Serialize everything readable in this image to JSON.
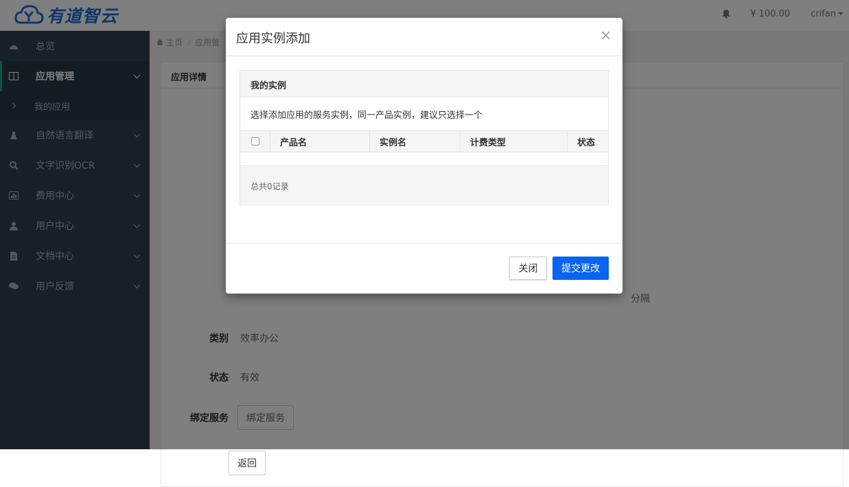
{
  "brand": {
    "name": "有道智云"
  },
  "topbar": {
    "balance": "¥ 100.00",
    "username": "crifan"
  },
  "sidebar": {
    "items": [
      {
        "label": "总览"
      },
      {
        "label": "应用管理"
      },
      {
        "label": "自然语言翻译"
      },
      {
        "label": "文字识别OCR"
      },
      {
        "label": "费用中心"
      },
      {
        "label": "用户中心"
      },
      {
        "label": "文档中心"
      },
      {
        "label": "用户反馈"
      }
    ],
    "sub_item": "我的应用"
  },
  "breadcrumb": {
    "home": "主页",
    "current": "应用管"
  },
  "panel": {
    "title": "应用详情"
  },
  "fields": {
    "category_label": "类别",
    "category_value": "效率办公",
    "status_label": "状态",
    "status_value": "有效",
    "bind_label": "绑定服务",
    "bind_button": "绑定服务",
    "hidden_suffix": "分隔"
  },
  "back_button": "返回",
  "modal": {
    "title": "应用实例添加",
    "close_glyph": "×",
    "section_title": "我的实例",
    "description": "选择添加应用的服务实例，同一产品实例，建议只选择一个",
    "columns": [
      "产品名",
      "实例名",
      "计费类型",
      "状态"
    ],
    "total": "总共0记录",
    "close_button": "关闭",
    "submit_button": "提交更改"
  },
  "colors": {
    "sidebar_bg": "#2f4050",
    "accent_blue": "#0a64f2",
    "brand_blue": "#1a6fd6"
  }
}
